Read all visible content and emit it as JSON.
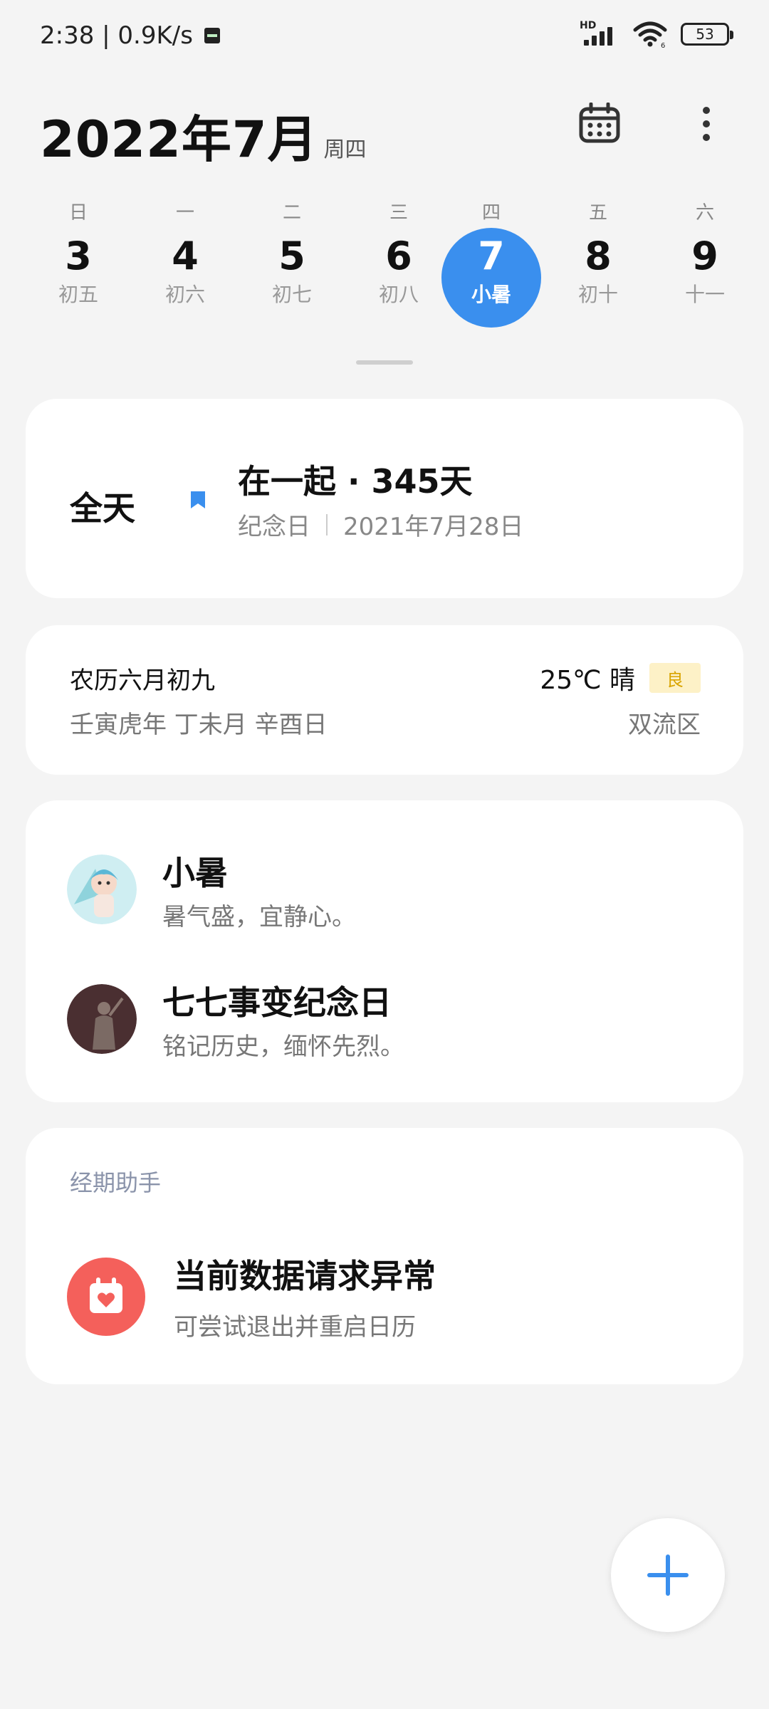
{
  "status_bar": {
    "time_speed": "2:38 | 0.9K/s",
    "network_label": "HD",
    "wifi_label": "6",
    "battery": "53"
  },
  "header": {
    "title": "2022年7月",
    "weekday": "周四"
  },
  "week": [
    {
      "weekday": "日",
      "day": "3",
      "lunar": "初五"
    },
    {
      "weekday": "一",
      "day": "4",
      "lunar": "初六"
    },
    {
      "weekday": "二",
      "day": "5",
      "lunar": "初七"
    },
    {
      "weekday": "三",
      "day": "6",
      "lunar": "初八"
    },
    {
      "weekday": "四",
      "day": "7",
      "lunar": "小暑"
    },
    {
      "weekday": "五",
      "day": "8",
      "lunar": "初十"
    },
    {
      "weekday": "六",
      "day": "9",
      "lunar": "十一"
    }
  ],
  "anniversary": {
    "all_day": "全天",
    "title": "在一起 · 345天",
    "type": "纪念日",
    "date": "2021年7月28日"
  },
  "lunar_card": {
    "lunar_date": "农历六月初九",
    "ganzhi": "壬寅虎年 丁未月 辛酉日",
    "weather": "25℃ 晴",
    "aqi": "良",
    "district": "双流区"
  },
  "events": [
    {
      "title": "小暑",
      "desc": "暑气盛，宜静心。"
    },
    {
      "title": "七七事变纪念日",
      "desc": "铭记历史，缅怀先烈。"
    }
  ],
  "period": {
    "header": "经期助手",
    "title": "当前数据请求异常",
    "desc": "可尝试退出并重启日历"
  },
  "colors": {
    "accent": "#3a8fee",
    "period_icon": "#f4605b",
    "aqi_bg": "#fdf1c7"
  }
}
